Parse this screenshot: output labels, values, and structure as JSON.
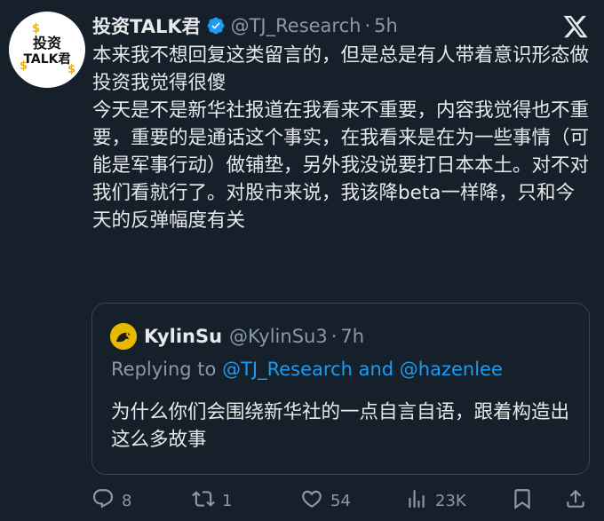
{
  "author": {
    "display_name": "投资TALK君",
    "handle": "@TJ_Research",
    "separator": "·",
    "time": "5h",
    "avatar": {
      "line1": "投资",
      "line2": "TALK君"
    }
  },
  "tweet": {
    "paragraphs": [
      "本来我不想回复这类留言的，但是总是有人带着意识形态做投资我觉得很傻",
      "今天是不是新华社报道在我看来不重要，内容我觉得也不重要，重要的是通话这个事实，在我看来是在为一些事情（可能是军事行动）做铺垫，另外我没说要打日本本土。对不对我们看就行了。对股市来说，我该降beta一样降，只和今天的反弹幅度有关"
    ]
  },
  "quote": {
    "display_name": "KylinSu",
    "handle": "@KylinSu3",
    "separator": "·",
    "time": "7h",
    "reply_prefix": "Replying to ",
    "reply_mention_1": "@TJ_Research",
    "reply_and": " and ",
    "reply_mention_2": "@hazenlee",
    "text": "为什么你们会围绕新华社的一点自言自语，跟着构造出这么多故事"
  },
  "actions": {
    "reply_count": "8",
    "retweet_count": "1",
    "like_count": "54",
    "view_count": "23K"
  },
  "colors": {
    "background": "#15202b",
    "text": "#e7e9ea",
    "muted": "#8b98a5",
    "link": "#1d9bf0",
    "border": "#38444d"
  },
  "icons": [
    "verified-badge-icon",
    "x-logo-icon",
    "reply-icon",
    "retweet-icon",
    "like-icon",
    "views-icon",
    "bookmark-icon",
    "share-icon"
  ]
}
